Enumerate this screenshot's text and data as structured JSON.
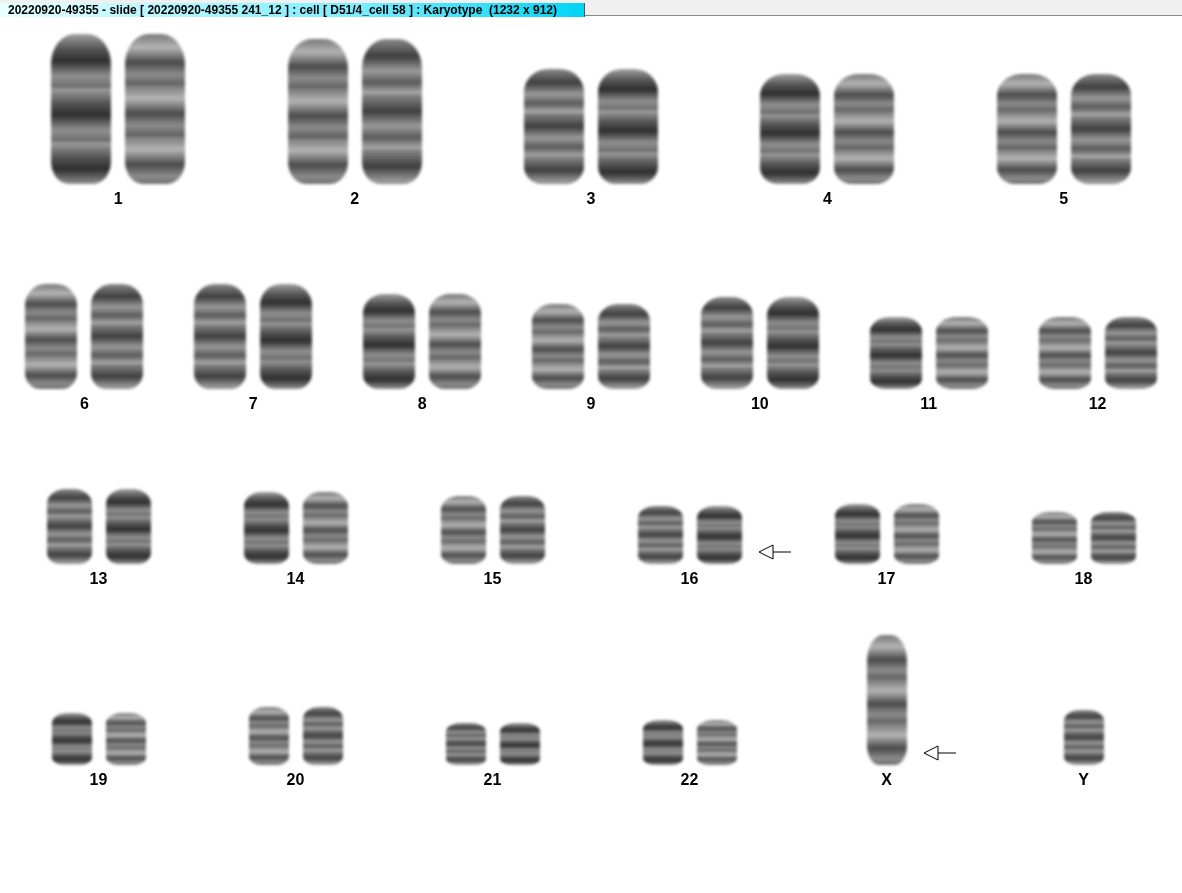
{
  "window": {
    "title": "20220920-49355 - slide [ 20220920-49355 241_12 ] : cell [ D51/4_cell 58 ] : Karyotype  (1232 x 912)"
  },
  "rows": [
    {
      "chromosomes": [
        {
          "label": "1",
          "kind": "pair",
          "marked": false
        },
        {
          "label": "2",
          "kind": "pair",
          "marked": false
        },
        {
          "label": "3",
          "kind": "pair",
          "marked": false
        },
        {
          "label": "4",
          "kind": "pair",
          "marked": false
        },
        {
          "label": "5",
          "kind": "pair",
          "marked": false
        }
      ]
    },
    {
      "chromosomes": [
        {
          "label": "6",
          "kind": "pair",
          "marked": false
        },
        {
          "label": "7",
          "kind": "pair",
          "marked": false
        },
        {
          "label": "8",
          "kind": "pair",
          "marked": false
        },
        {
          "label": "9",
          "kind": "pair",
          "marked": false
        },
        {
          "label": "10",
          "kind": "pair",
          "marked": false
        },
        {
          "label": "11",
          "kind": "pair",
          "marked": false
        },
        {
          "label": "12",
          "kind": "pair",
          "marked": false
        }
      ]
    },
    {
      "chromosomes": [
        {
          "label": "13",
          "kind": "pair",
          "marked": false
        },
        {
          "label": "14",
          "kind": "pair",
          "marked": false
        },
        {
          "label": "15",
          "kind": "pair",
          "marked": false
        },
        {
          "label": "16",
          "kind": "pair",
          "marked": true
        },
        {
          "label": "17",
          "kind": "pair",
          "marked": false
        },
        {
          "label": "18",
          "kind": "pair",
          "marked": false
        }
      ]
    },
    {
      "chromosomes": [
        {
          "label": "19",
          "kind": "pair",
          "marked": false
        },
        {
          "label": "20",
          "kind": "pair",
          "marked": false
        },
        {
          "label": "21",
          "kind": "pair",
          "marked": false
        },
        {
          "label": "22",
          "kind": "pair",
          "marked": false
        },
        {
          "label": "X",
          "kind": "single",
          "marked": true
        },
        {
          "label": "Y",
          "kind": "single",
          "marked": false
        }
      ]
    }
  ]
}
